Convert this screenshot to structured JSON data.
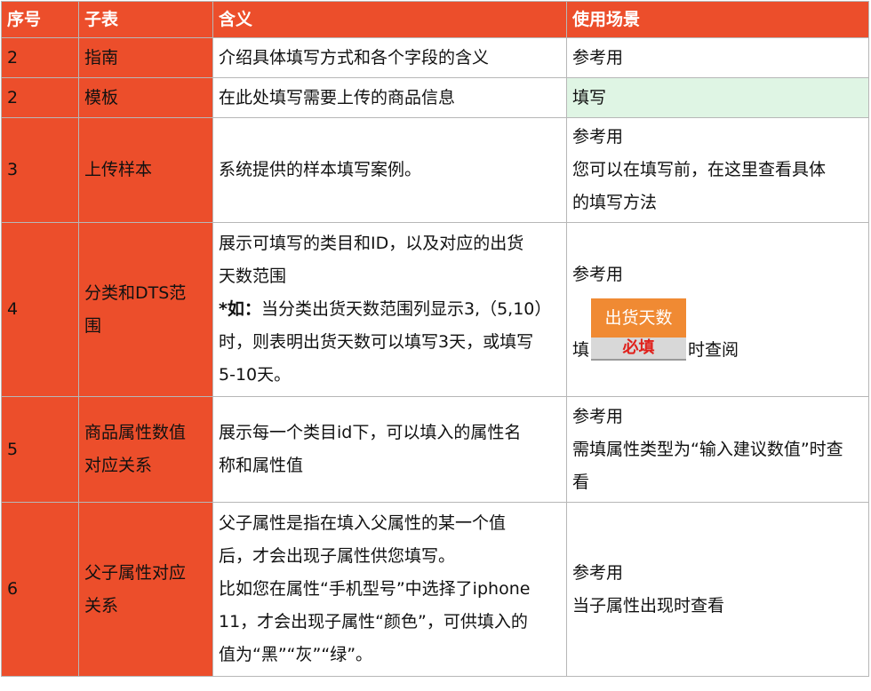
{
  "headers": [
    "序号",
    "子表",
    "含义",
    "使用场景"
  ],
  "rows": [
    {
      "no": "2",
      "sheet": "指南",
      "meaning": [
        "介绍具体填写方式和各个字段的含义"
      ],
      "usage": [
        "参考用"
      ]
    },
    {
      "no": "2",
      "sheet": "模板",
      "meaning": [
        "在此处填写需要上传的商品信息"
      ],
      "usage": [
        "填写"
      ]
    },
    {
      "no": "3",
      "sheet": "上传样本",
      "meaning": [
        "系统提供的样本填写案例。"
      ],
      "usage": [
        "参考用",
        "您可以在填写前，在这里查看具体",
        "的填写方法"
      ]
    },
    {
      "no": "4",
      "sheet_lines": [
        "分类和DTS范",
        "围"
      ],
      "meaning": [
        "展示可填写的类目和ID，以及对应的出货",
        "天数范围"
      ],
      "meaning_bold": "*如：",
      "meaning_rest": [
        "当分类出货天数范围列显示3,（5,10）",
        "时，则表明出货天数可以填写3天，或填写",
        "5-10天。"
      ],
      "usage_top": "参考用",
      "usage_prefix": "填",
      "badge_top": "出货天数",
      "badge_bottom": "必填",
      "usage_suffix": "时查阅"
    },
    {
      "no": "5",
      "sheet_lines": [
        "商品属性数值",
        "对应关系"
      ],
      "meaning": [
        "展示每一个类目id下，可以填入的属性名",
        "称和属性值"
      ],
      "usage": [
        "参考用",
        "需填属性类型为“输入建议数值”时查",
        "看"
      ]
    },
    {
      "no": "6",
      "sheet_lines": [
        "父子属性对应",
        "关系"
      ],
      "meaning": [
        "父子属性是指在填入父属性的某一个值",
        "后，才会出现子属性供您填写。",
        "比如您在属性“手机型号”中选择了iphone",
        "11，才会出现子属性“颜色”，可供填入的",
        "值为“黑”“灰”“绿”。"
      ],
      "usage": [
        "参考用",
        "当子属性出现时查看"
      ]
    }
  ]
}
